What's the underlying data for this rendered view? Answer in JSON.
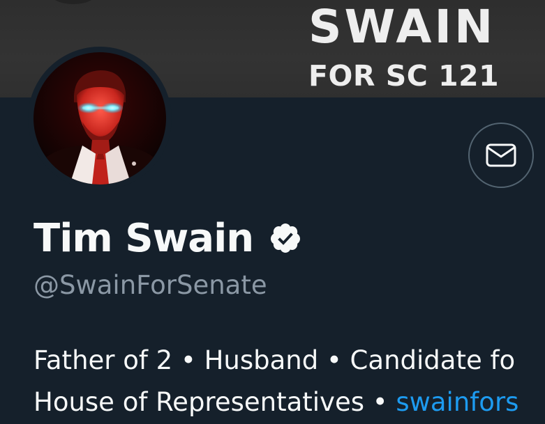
{
  "banner": {
    "line1": "SWAIN",
    "line2": "FOR SC 121"
  },
  "profile": {
    "display_name": "Tim Swain",
    "handle": "@SwainForSenate",
    "verified": true,
    "avatar_icon": "profile-photo",
    "message_icon": "envelope-icon"
  },
  "bio": {
    "line1": "Father of 2 • Husband • Candidate fo",
    "line2_text": "House of Representatives • ",
    "link": "swainfors"
  },
  "colors": {
    "background": "#15202b",
    "text_primary": "#f7f9f9",
    "text_secondary": "#8b98a5",
    "link": "#1d9bf0",
    "banner": "#333333"
  }
}
